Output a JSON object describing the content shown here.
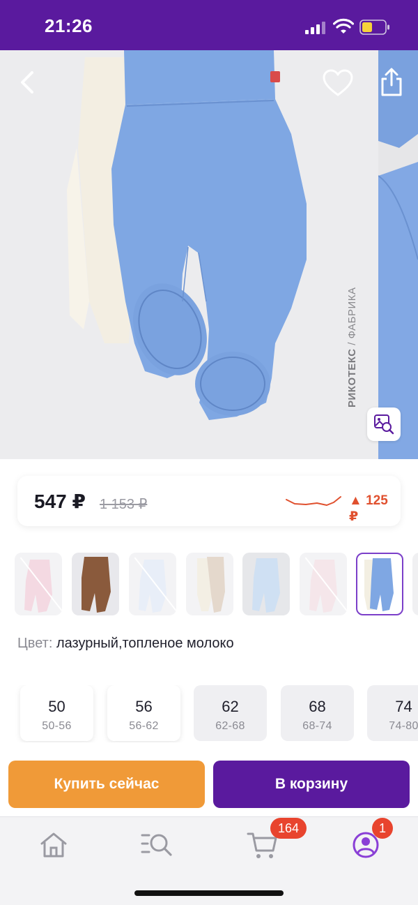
{
  "status_bar": {
    "time": "21:26"
  },
  "product": {
    "watermark_brand": "РИКОТЕКС",
    "watermark_suffix": " / ФАБРИКА",
    "image_color": "#7fa7e3"
  },
  "price": {
    "current": "547 ₽",
    "old": "1 153 ₽",
    "change": "▲ 125 ₽"
  },
  "color_variants": [
    {
      "name": "pink",
      "available": false
    },
    {
      "name": "brown",
      "available": true
    },
    {
      "name": "white",
      "available": false
    },
    {
      "name": "beige-milk",
      "available": true
    },
    {
      "name": "light-blue",
      "available": true
    },
    {
      "name": "light-pink",
      "available": false
    },
    {
      "name": "azure-milk",
      "available": true,
      "selected": true
    }
  ],
  "color_info": {
    "label": "Цвет: ",
    "value": "лазурный,топленое молоко"
  },
  "sizes": [
    {
      "size": "50",
      "range": "50-56"
    },
    {
      "size": "56",
      "range": "56-62"
    },
    {
      "size": "62",
      "range": "62-68"
    },
    {
      "size": "68",
      "range": "68-74"
    },
    {
      "size": "74",
      "range": "74-80"
    }
  ],
  "actions": {
    "buy_now": "Купить сейчас",
    "add_to_cart": "В корзину"
  },
  "tab_bar": {
    "cart_badge": "164",
    "profile_badge": "1"
  },
  "colors": {
    "brand_purple": "#5a1a9e",
    "buy_orange": "#f09a38",
    "badge_red": "#e8442e",
    "price_up_red": "#e0502e"
  }
}
